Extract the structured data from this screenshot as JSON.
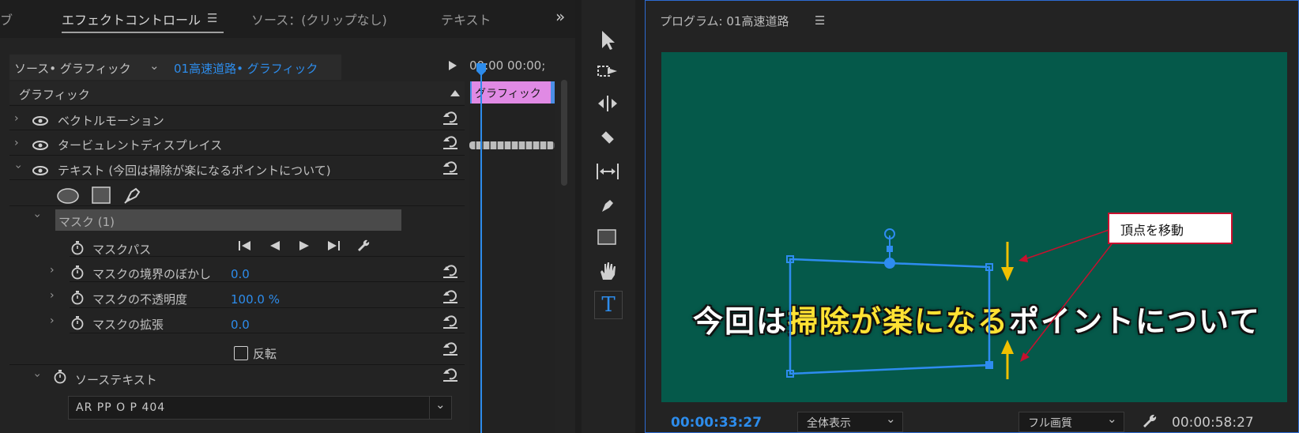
{
  "left_panel": {
    "tabs": {
      "partial": "ブ",
      "effect_controls": "エフェクトコントロール",
      "source": "ソース：(クリップなし)",
      "text": "テキスト",
      "more": "»"
    },
    "source_bar": {
      "source_label": "ソース• グラフィック",
      "clip_label": "01高速道路• グラフィック",
      "timecode": "00:00  00:00;"
    },
    "clip_name": "グラフィック",
    "section_title": "グラフィック",
    "effects": [
      {
        "label": "ベクトルモーション"
      },
      {
        "label": "タービュレントディスプレイス"
      },
      {
        "label": "テキスト (今回は掃除が楽になるポイントについて)"
      }
    ],
    "mask": {
      "name": "マスク (1)",
      "path_label": "マスクパス",
      "feather_label": "マスクの境界のぼかし",
      "feather_value": "0.0",
      "opacity_label": "マスクの不透明度",
      "opacity_value": "100.0 %",
      "expansion_label": "マスクの拡張",
      "expansion_value": "0.0",
      "invert_label": "反転"
    },
    "source_text_label": "ソーステキスト",
    "font_value": "AR PP O P 404"
  },
  "program": {
    "title": "プログラム: 01高速道路",
    "caption_pre": "今回は",
    "caption_highlight": "掃除が楽になる",
    "caption_post": "ポイントについて",
    "annotation": "頂点を移動",
    "current_time": "00:00:33:27",
    "zoom": "全体表示",
    "quality": "フル画質",
    "duration": "00:00:58:27"
  },
  "colors": {
    "accent": "#2d8ceb",
    "video_bg": "#05594a",
    "clip": "#e08ae4",
    "arrow": "#f0c000",
    "callout": "#c8102e"
  }
}
